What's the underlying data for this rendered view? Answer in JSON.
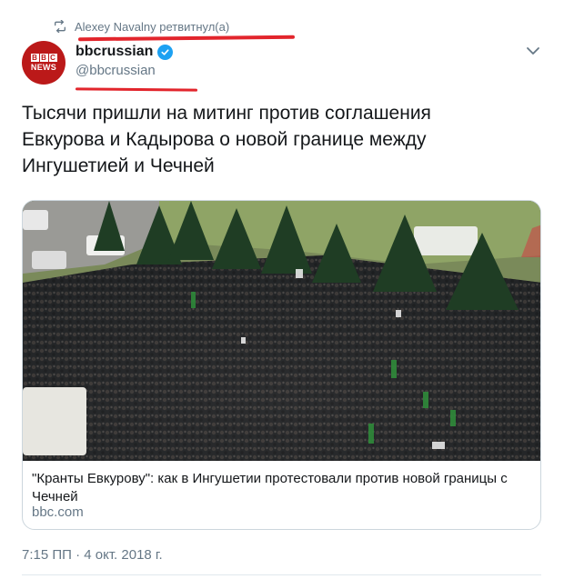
{
  "retweet": {
    "text": "Alexey Navalny ретвитнул(а)"
  },
  "author": {
    "display_name": "bbcrussian",
    "screen_name": "@bbcrussian",
    "verified": true,
    "avatar_logo": "BBC",
    "avatar_subtext": "NEWS"
  },
  "tweet": {
    "text_lines": [
      "Тысячи пришли на митинг против соглашения",
      "Евкурова и Кадырова о новой границе между",
      "Ингушетией и Чечней"
    ]
  },
  "card": {
    "title": "\"Кранты Евкурову\": как в Ингушетии протестовали против новой границы с Чечней",
    "domain": "bbc.com"
  },
  "meta": {
    "timestamp": "7:15 ПП · 4 окт. 2018 г."
  },
  "colors": {
    "accent_blue": "#1da1f2",
    "bbc_red": "#bb1919",
    "annotation_red": "#e2252c",
    "secondary_text": "#657786"
  },
  "icons": {
    "retweet": "retweet-icon",
    "verified": "verified-badge-icon",
    "menu": "chevron-down-icon"
  }
}
